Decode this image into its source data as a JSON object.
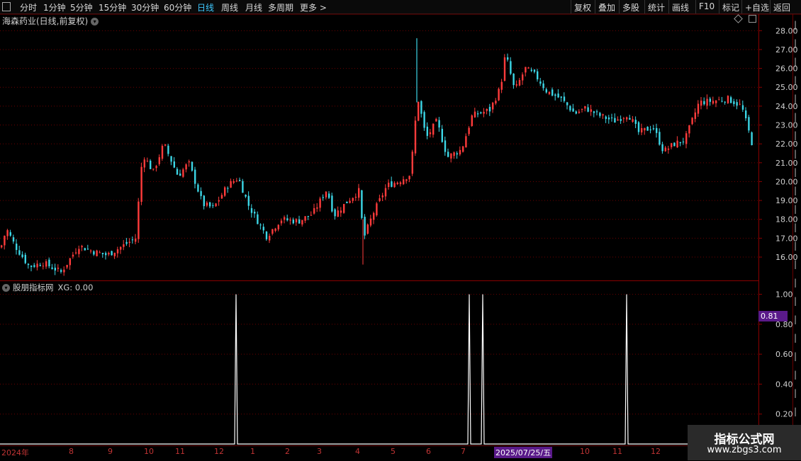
{
  "toolbar": {
    "left": [
      "分时",
      "1分钟",
      "5分钟",
      "15分钟",
      "30分钟",
      "60分钟",
      "日线",
      "周线",
      "月线",
      "多周期",
      "更多 >"
    ],
    "right": [
      "复权",
      "叠加",
      "多股",
      "统计",
      "画线",
      "F10",
      "标记",
      "+自选",
      "返回"
    ],
    "active": "日线"
  },
  "chart": {
    "title": "海森药业(日线,前复权)",
    "price_ticks": [
      "28.00",
      "27.00",
      "26.00",
      "25.00",
      "24.00",
      "23.00",
      "22.00",
      "21.00",
      "20.00",
      "19.00",
      "18.00",
      "17.00",
      "16.00"
    ],
    "price_range": [
      14.8,
      28.5
    ],
    "up_color": "#ff3b3b",
    "down_color": "#3cd6e6"
  },
  "indicator": {
    "title": "股朋指标网",
    "value_text": "XG: 0.00",
    "ticks": [
      "1.00",
      "0.80",
      "0.60",
      "0.40",
      "0.20"
    ],
    "cursor_value": "0.81"
  },
  "xaxis": {
    "labels": [
      "2024年",
      "8",
      "9",
      "10",
      "11",
      "12",
      "1",
      "2",
      "3",
      "4",
      "5",
      "6",
      "7",
      "2025/07/25/五",
      "10",
      "11",
      "12"
    ]
  },
  "watermark": {
    "line1": "指标公式网",
    "line2": "www.zbgs3.com"
  },
  "chart_data": {
    "type": "candlestick",
    "title": "海森药业(日线,前复权)",
    "ylim": [
      14.8,
      28.5
    ],
    "approx_close_path": [
      [
        0,
        16.5
      ],
      [
        8,
        17.5
      ],
      [
        20,
        16.6
      ],
      [
        40,
        15.5
      ],
      [
        60,
        15.7
      ],
      [
        85,
        15.2
      ],
      [
        110,
        16.6
      ],
      [
        130,
        16.3
      ],
      [
        150,
        16.1
      ],
      [
        190,
        17.0
      ],
      [
        200,
        21.5
      ],
      [
        215,
        20.5
      ],
      [
        230,
        22.0
      ],
      [
        250,
        20.3
      ],
      [
        265,
        21.0
      ],
      [
        285,
        18.8
      ],
      [
        300,
        18.6
      ],
      [
        320,
        19.8
      ],
      [
        335,
        20.2
      ],
      [
        350,
        18.7
      ],
      [
        375,
        17.1
      ],
      [
        395,
        18.0
      ],
      [
        420,
        17.9
      ],
      [
        440,
        18.3
      ],
      [
        460,
        19.6
      ],
      [
        470,
        18.2
      ],
      [
        490,
        19.0
      ],
      [
        505,
        19.5
      ],
      [
        512,
        17.0
      ],
      [
        525,
        18.3
      ],
      [
        545,
        19.8
      ],
      [
        560,
        20.0
      ],
      [
        578,
        20.4
      ],
      [
        588,
        24.5
      ],
      [
        600,
        22.3
      ],
      [
        615,
        23.2
      ],
      [
        630,
        21.3
      ],
      [
        650,
        21.7
      ],
      [
        665,
        23.5
      ],
      [
        690,
        23.8
      ],
      [
        705,
        25.0
      ],
      [
        712,
        26.8
      ],
      [
        725,
        24.8
      ],
      [
        740,
        26.0
      ],
      [
        755,
        25.6
      ],
      [
        770,
        24.8
      ],
      [
        790,
        24.4
      ],
      [
        810,
        23.6
      ],
      [
        825,
        23.9
      ],
      [
        845,
        23.5
      ],
      [
        865,
        23.2
      ],
      [
        885,
        23.6
      ],
      [
        900,
        22.6
      ],
      [
        920,
        22.9
      ],
      [
        935,
        21.6
      ],
      [
        950,
        22.0
      ],
      [
        965,
        22.2
      ],
      [
        985,
        24.2
      ],
      [
        1010,
        24.3
      ],
      [
        1025,
        24.4
      ],
      [
        1045,
        24.0
      ],
      [
        1060,
        22.0
      ]
    ],
    "indicator_series": {
      "name": "XG",
      "signal_positions": [
        333,
        662,
        681,
        884
      ],
      "value_at_signal": 1.0,
      "ylim": [
        0,
        1.05
      ]
    }
  }
}
